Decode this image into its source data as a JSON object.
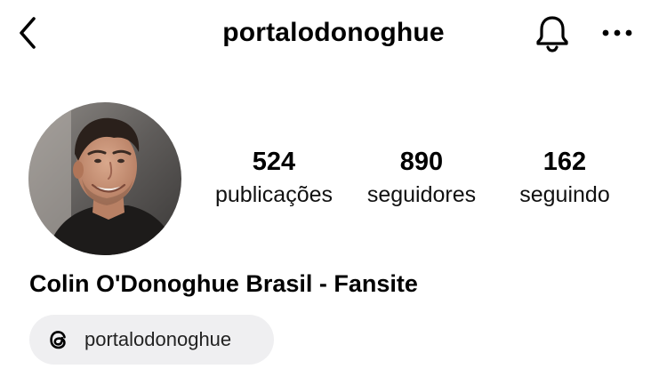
{
  "header": {
    "username": "portalodonoghue",
    "back_icon": "chevron-left-icon",
    "notification_icon": "bell-icon",
    "more_icon": "more-horizontal-icon"
  },
  "profile": {
    "avatar_description": "profile-photo",
    "display_name": "Colin O'Donoghue Brasil - Fansite",
    "stats": {
      "posts": {
        "value": "524",
        "label": "publicações"
      },
      "followers": {
        "value": "890",
        "label": "seguidores"
      },
      "following": {
        "value": "162",
        "label": "seguindo"
      }
    },
    "threads": {
      "icon": "threads-icon",
      "handle": "portalodonoghue"
    }
  },
  "colors": {
    "background": "#ffffff",
    "text": "#000000",
    "chip_background": "#efeff1"
  }
}
